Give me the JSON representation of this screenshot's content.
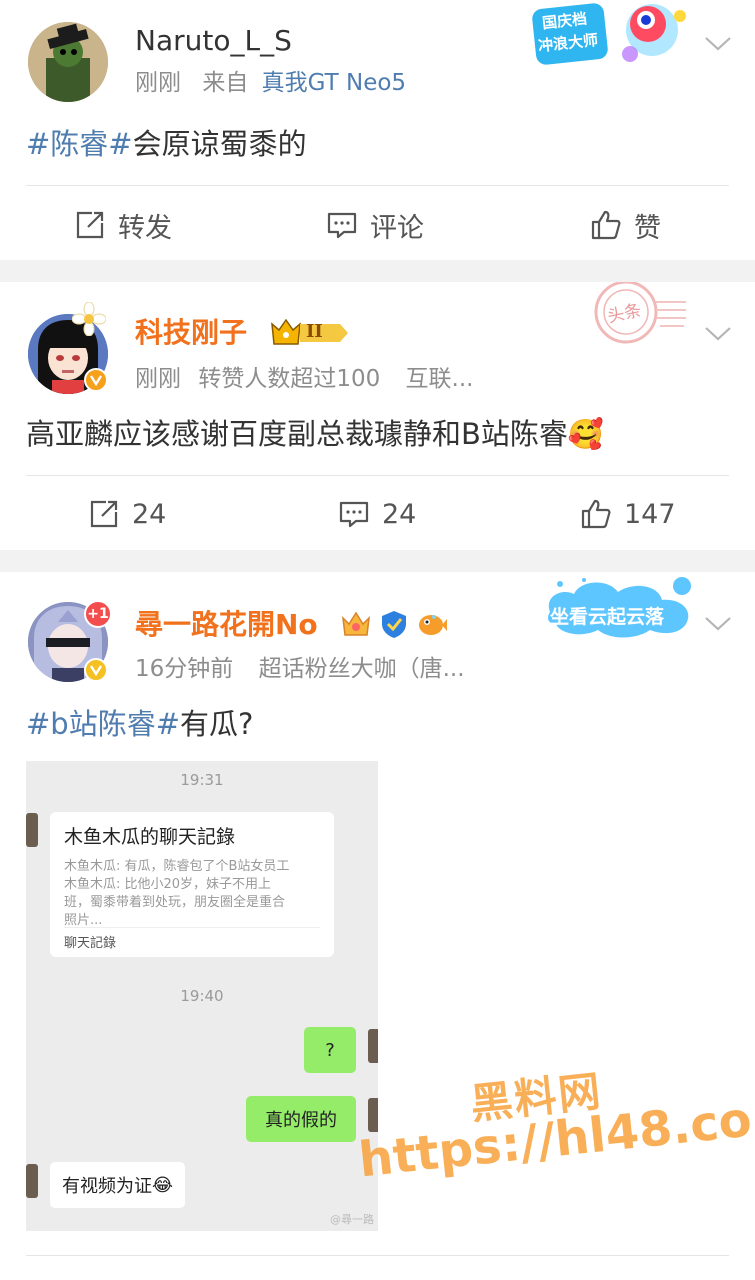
{
  "posts": [
    {
      "username": "Naruto_L_S",
      "time": "刚刚",
      "source_prefix": "来自",
      "source_device": "真我GT Neo5",
      "topic": "#陈睿#",
      "text": "会原谅蜀黍的",
      "badge_text": [
        "国庆档",
        "冲浪大师"
      ],
      "actions": {
        "repost": "转发",
        "comment": "评论",
        "like": "赞"
      }
    },
    {
      "username": "科技刚子",
      "level_badge": "II",
      "time": "刚刚",
      "meta_extra": "转赞人数超过100",
      "meta_extra2": "互联...",
      "stamp_text": "头条",
      "text": "高亚麟应该感谢百度副总裁璩静和B站陈睿",
      "emoji": "🥰",
      "actions": {
        "repost": "24",
        "comment": "24",
        "like": "147"
      }
    },
    {
      "username": "尋一路花開No",
      "notif_count": "+1",
      "time": "16分钟前",
      "meta_extra": "超话粉丝大咖（唐...",
      "badge_text": "坐看云起云落",
      "topic": "#b站陈睿#",
      "text": "有瓜?",
      "chat": {
        "time1": "19:31",
        "card_title": "木鱼木瓜的聊天記錄",
        "card_lines": [
          "木鱼木瓜: 有瓜，陈睿包了个B站女员工",
          "木鱼木瓜: 比他小20岁，妹子不用上",
          "班，蜀黍带着到处玩，朋友圈全是重合",
          "照片..."
        ],
        "card_footer": "聊天記錄",
        "time2": "19:40",
        "msg_q": "?",
        "msg_real": "真的假的",
        "msg_video": "有视频为证",
        "msg_video_emoji": "😂",
        "chat_watermark": "@尋一路"
      }
    }
  ],
  "watermark": {
    "line1": "黑料网",
    "line2": "https://hl48.co"
  },
  "colors": {
    "link": "#507daf",
    "vip_name": "#f2711c",
    "meta": "#8d8d8d",
    "verified_orange": "#f7a01a",
    "verified_yellow": "#f5c022"
  }
}
